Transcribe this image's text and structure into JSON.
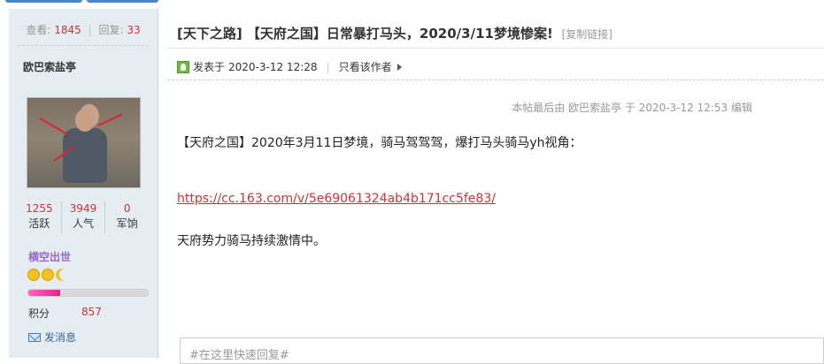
{
  "sidebar": {
    "views_label": "查看:",
    "views_value": "1845",
    "replies_label": "回复:",
    "replies_value": "33",
    "author": "欧巴索盐亭",
    "profile_stats": [
      {
        "value": "1255",
        "label": "活跃"
      },
      {
        "value": "3949",
        "label": "人气"
      },
      {
        "value": "0",
        "label": "军饷"
      }
    ],
    "rank": "横空出世",
    "progress_fraction": 0.27,
    "credit_label": "积分",
    "credit_value": "857",
    "send_message": "发消息"
  },
  "post": {
    "title": "[天下之路] 【天府之国】日常暴打马头，2020/3/11梦境惨案!",
    "copy_link": "[复制链接]",
    "posted_prefix": "发表于",
    "posted_time": "2020-3-12 12:28",
    "author_only": "只看该作者",
    "edited_note": "本帖最后由 欧巴索盐亭 于 2020-3-12 12:53 编辑",
    "line1": "【天府之国】2020年3月11日梦境，骑马驾驾驾，爆打马头骑马yh视角：",
    "link": "https://cc.163.com/v/5e69061324ab4b171cc5fe83/",
    "line3": "天府势力骑马持续激情中。"
  },
  "reply": {
    "placeholder": "#在这里快速回复#"
  },
  "colors": {
    "accent_red": "#cc3333",
    "rank_purple": "#9966cc",
    "sidebar_bg": "#e5edf2",
    "link_blue": "#336699"
  },
  "icons": [
    "online-status-icon",
    "arrow-right-icon",
    "mail-icon",
    "smiley-icon",
    "moon-icon"
  ]
}
